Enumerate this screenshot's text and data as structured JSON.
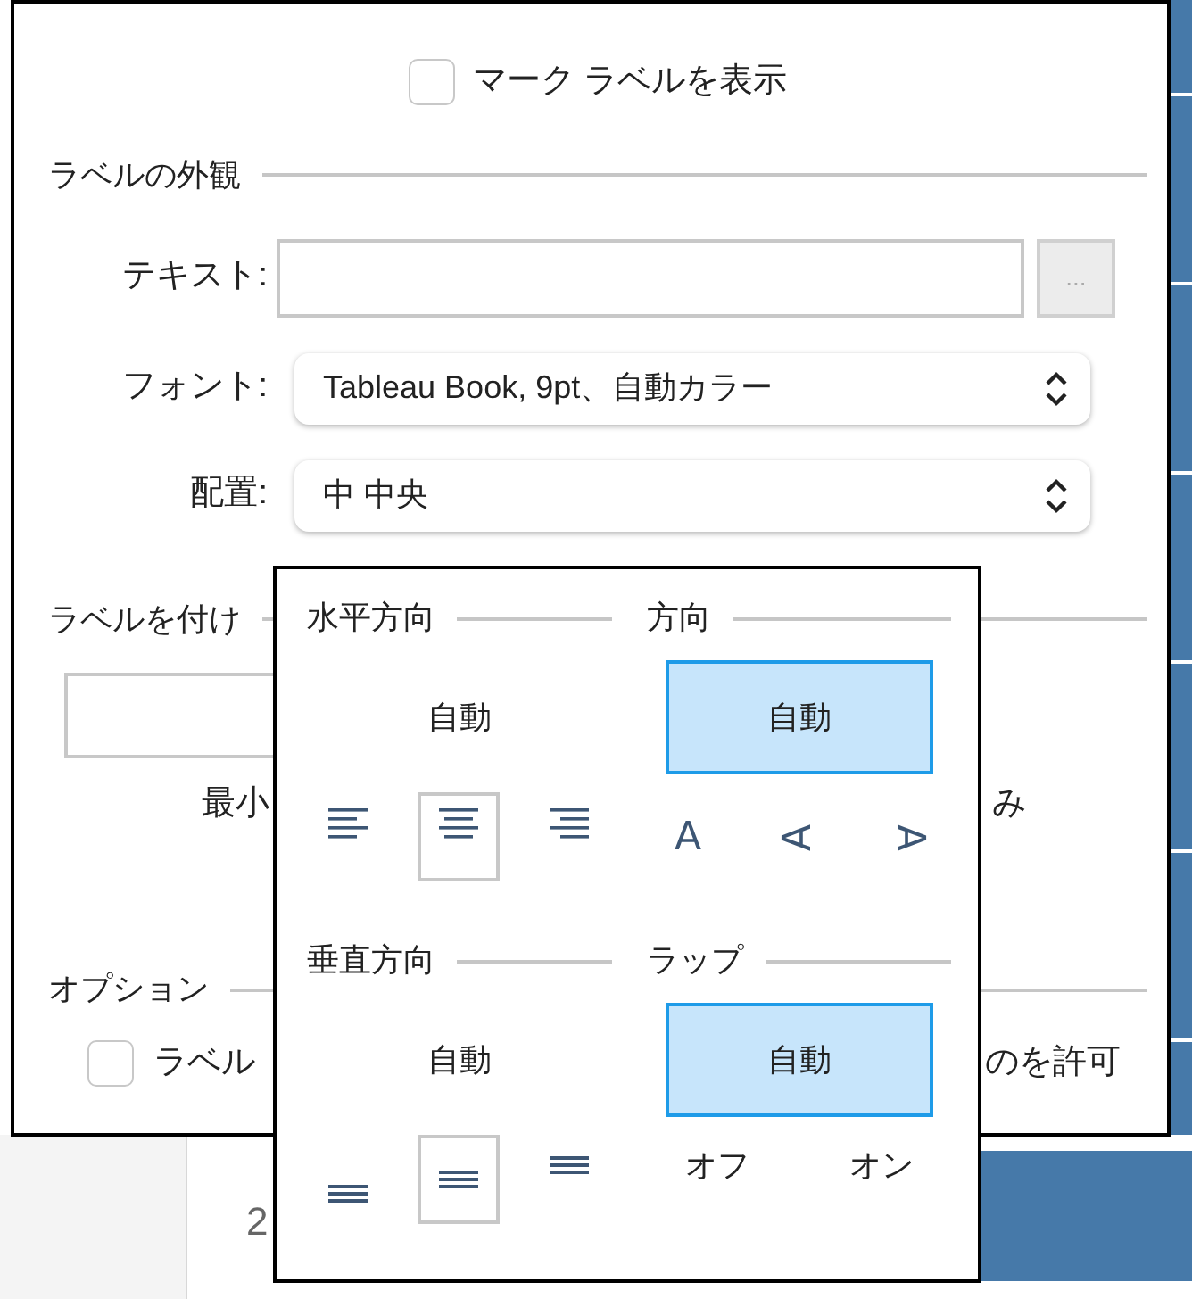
{
  "background": {
    "axis_label": "2"
  },
  "dialog": {
    "show_labels": {
      "label": "マーク ラベルを表示",
      "checked": false
    },
    "appearance": {
      "title": "ラベルの外観",
      "text_label": "テキスト:",
      "more_button": "...",
      "font_label": "フォント:",
      "font_value": "Tableau Book, 9pt、自動カラー",
      "alignment_label": "配置:",
      "alignment_value": "中 中央"
    },
    "labeling": {
      "title": "ラベルを付け",
      "caption_left": "最小",
      "caption_right": "み"
    },
    "options": {
      "title": "オプション",
      "overlap": {
        "label_start": "ラベル",
        "label_end": "のを許可",
        "checked": false
      }
    }
  },
  "alignment_popup": {
    "sections": [
      {
        "title": "水平方向",
        "auto": {
          "label": "自動",
          "selected": false
        },
        "choices": [
          {
            "kind": "h-left",
            "selected": false
          },
          {
            "kind": "h-center",
            "selected": true
          },
          {
            "kind": "h-right",
            "selected": false
          }
        ]
      },
      {
        "title": "方向",
        "auto": {
          "label": "自動",
          "selected": true
        },
        "choices": [
          {
            "kind": "upright",
            "label": "A",
            "selected": false
          },
          {
            "kind": "rotate-left",
            "label": "A",
            "selected": false
          },
          {
            "kind": "rotate-right",
            "label": "A",
            "selected": false
          }
        ]
      },
      {
        "title": "垂直方向",
        "auto": {
          "label": "自動",
          "selected": false
        },
        "choices": [
          {
            "kind": "v-bottom",
            "selected": false
          },
          {
            "kind": "v-middle",
            "selected": true
          },
          {
            "kind": "v-top",
            "selected": false
          }
        ]
      },
      {
        "title": "ラップ",
        "auto": {
          "label": "自動",
          "selected": true
        },
        "choices": [
          {
            "kind": "text",
            "label": "オフ",
            "selected": false
          },
          {
            "kind": "text",
            "label": "オン",
            "selected": false
          }
        ]
      }
    ]
  }
}
